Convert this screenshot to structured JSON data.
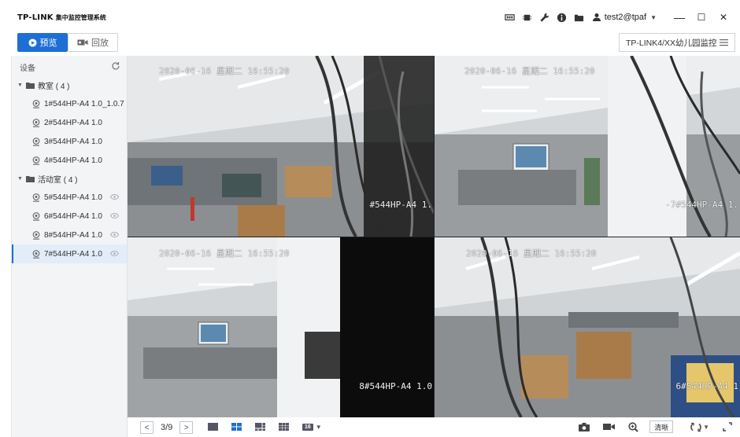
{
  "app": {
    "logo": "TP-LINK",
    "subtitle": "集中监控管理系统"
  },
  "header": {
    "icons": [
      "screen-icon",
      "chip-icon",
      "wrench-icon",
      "info-icon",
      "folder-icon"
    ],
    "user": "test2@tpaf",
    "minimize": "—",
    "maximize": "☐",
    "close": "✕"
  },
  "toolbar": {
    "preview_label": "预览",
    "playback_label": "回放",
    "site": "TP-LINK4/XX幼儿园监控"
  },
  "sidebar": {
    "title": "设备",
    "groups": [
      {
        "label": "教室 ( 4 )",
        "devices": [
          {
            "label": "1#544HP-A4 1.0_1.0.7"
          },
          {
            "label": "2#544HP-A4 1.0"
          },
          {
            "label": "3#544HP-A4 1.0"
          },
          {
            "label": "4#544HP-A4 1.0"
          }
        ]
      },
      {
        "label": "活动室 ( 4 )",
        "devices": [
          {
            "label": "5#544HP-A4 1.0"
          },
          {
            "label": "6#544HP-A4 1.0"
          },
          {
            "label": "8#544HP-A4 1.0"
          },
          {
            "label": "7#544HP-A4 1.0"
          }
        ]
      }
    ]
  },
  "video": {
    "tiles": [
      {
        "time": "2020-06-16 星期二 16:55:20",
        "name": "#544HP-A4 1."
      },
      {
        "time": "2020-06-16 星期二 16:55:20",
        "name": "-7#544HP-A4 1."
      },
      {
        "time": "2020-06-16 星期二 16:55:20",
        "name": "8#544HP-A4 1.0"
      },
      {
        "time": "2020-06-16 星期二 16:55:20",
        "name": "6#544HP-A4 1"
      }
    ]
  },
  "bottom": {
    "page": "3/9",
    "prev": "<",
    "next": ">",
    "layout_count": "16",
    "quality": "清晰"
  },
  "colors": {
    "accent": "#1d6fd6",
    "selected_outline": "#3c8de6"
  }
}
